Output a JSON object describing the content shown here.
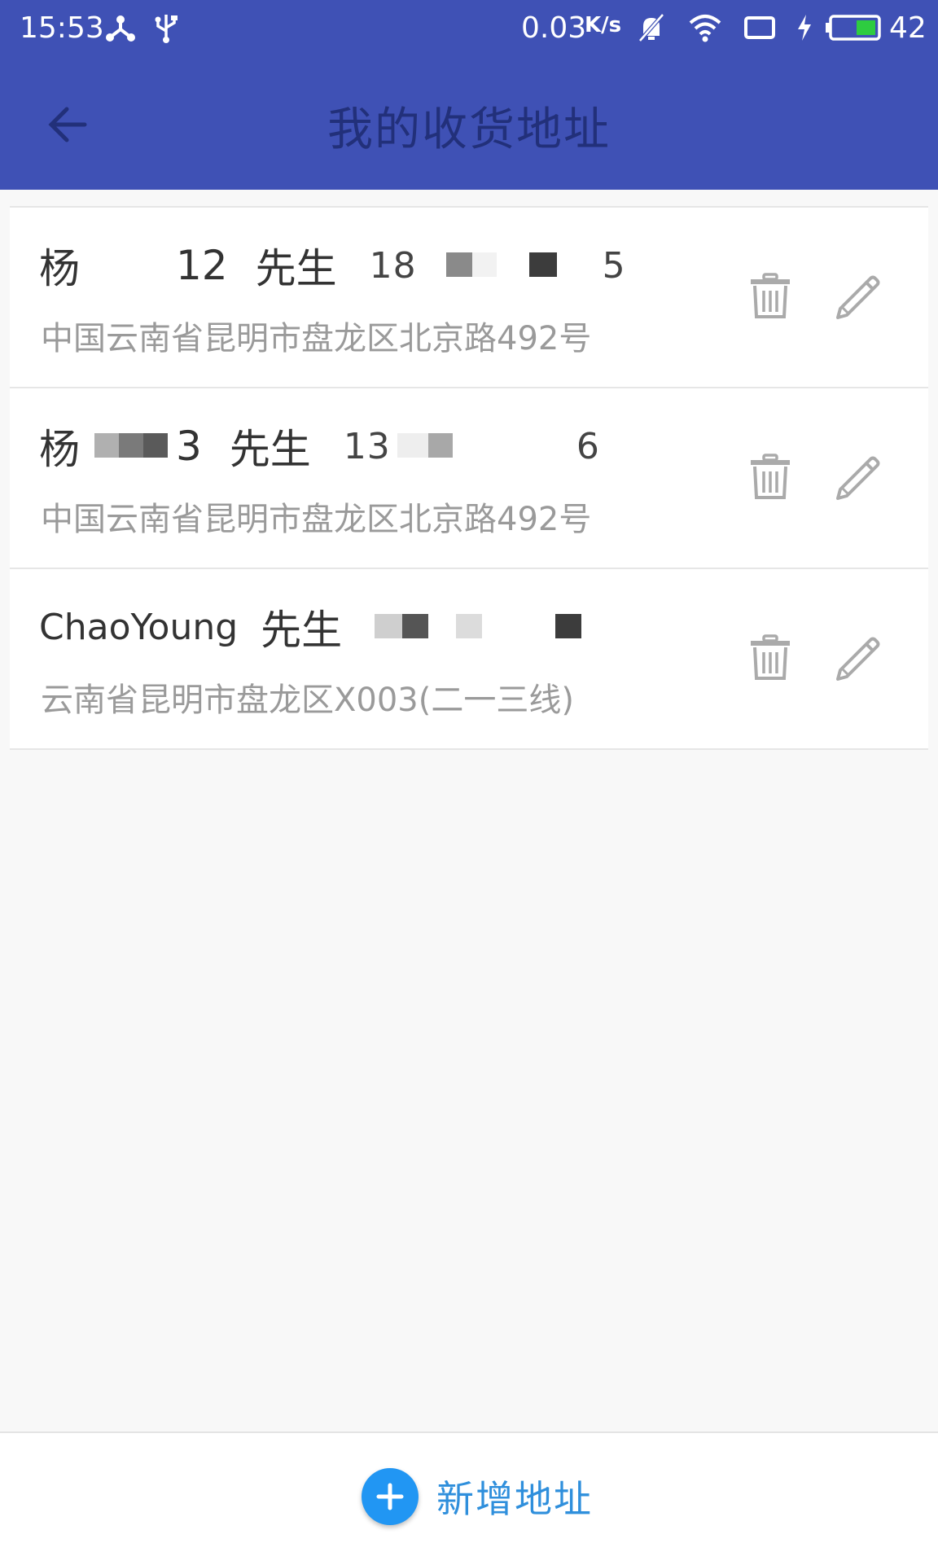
{
  "status_bar": {
    "time": "15:53",
    "net_speed": "0.03",
    "net_unit": "K/s",
    "battery_level": "42",
    "icons": [
      "share-icon",
      "usb-icon",
      "bell-off-icon",
      "wifi-icon",
      "screen-icon",
      "charging-icon",
      "battery-icon"
    ]
  },
  "app_bar": {
    "title": "我的收货地址",
    "back_icon": "arrow-left-icon"
  },
  "addresses": [
    {
      "name_prefix": "杨",
      "name_suffix": "12",
      "title": "先生",
      "phone_prefix": "18",
      "phone_suffix": "5",
      "address": "中国云南省昆明市盘龙区北京路492号"
    },
    {
      "name_prefix": "杨",
      "name_suffix": "3",
      "title": "先生",
      "phone_prefix": "13",
      "phone_suffix": "6",
      "address": "中国云南省昆明市盘龙区北京路492号"
    },
    {
      "name_prefix": "ChaoYoung",
      "name_suffix": "",
      "title": "先生",
      "phone_prefix": "",
      "phone_suffix": "",
      "address": "云南省昆明市盘龙区X003(二一三线)"
    }
  ],
  "actions": {
    "delete_icon": "trash-icon",
    "edit_icon": "pencil-icon"
  },
  "bottom_bar": {
    "add_label": "新增地址",
    "add_icon": "plus-circle-icon",
    "accent": "#2196f3"
  },
  "colors": {
    "primary": "#3f51b5",
    "title_text": "#22307a"
  }
}
